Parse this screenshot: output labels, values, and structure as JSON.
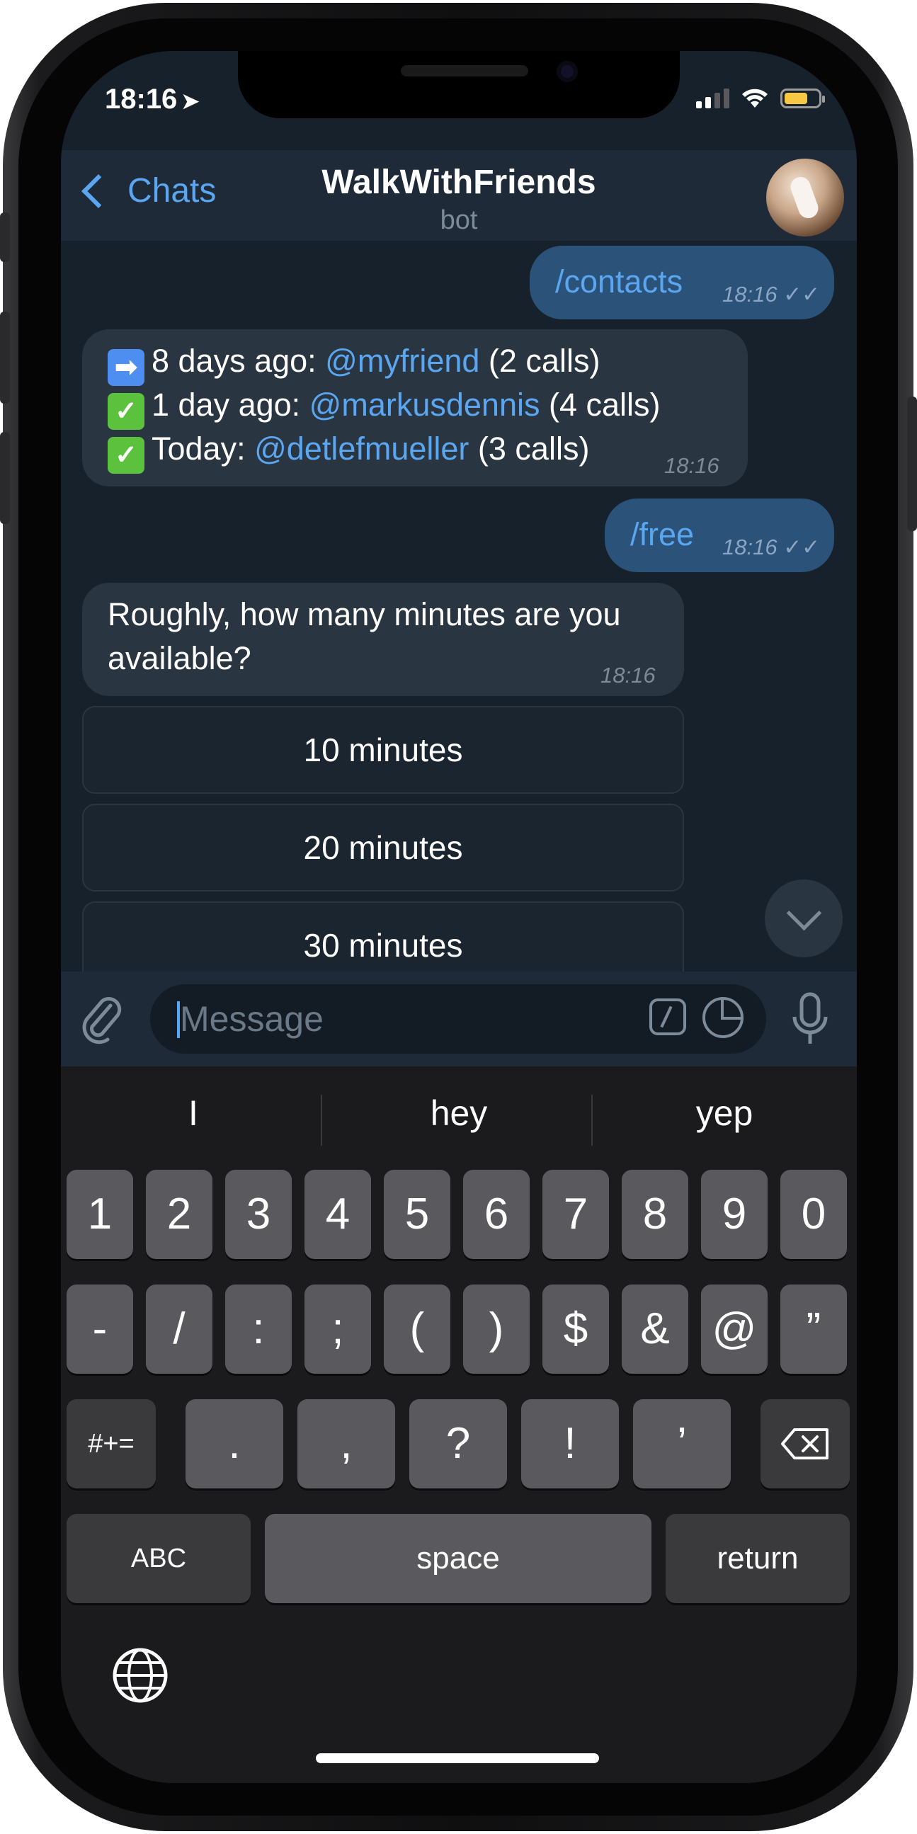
{
  "status_bar": {
    "time": "18:16",
    "location_glyph": "➤"
  },
  "header": {
    "back_label": "Chats",
    "title": "WalkWithFriends",
    "subtitle": "bot"
  },
  "messages": {
    "contacts_cmd": {
      "text": "/contacts",
      "time": "18:16",
      "read_glyph": "✓✓"
    },
    "contacts_list": {
      "rows": [
        {
          "emoji": "➡",
          "prefix": "8 days ago: ",
          "handle": "@myfriend",
          "suffix": " (2 calls)"
        },
        {
          "emoji": "✓",
          "prefix": "1 day ago: ",
          "handle": "@markusdennis",
          "suffix": " (4 calls)"
        },
        {
          "emoji": "✓",
          "prefix": "Today: ",
          "handle": "@detlefmueller",
          "suffix": " (3 calls)"
        }
      ],
      "time": "18:16"
    },
    "free_cmd": {
      "text": "/free",
      "time": "18:16",
      "read_glyph": "✓✓"
    },
    "question": {
      "line1": "Roughly, how many minutes are you",
      "line2": "available?",
      "time": "18:16"
    }
  },
  "keyboard_buttons": [
    "10 minutes",
    "20 minutes",
    "30 minutes"
  ],
  "input": {
    "placeholder": "Message"
  },
  "suggestions": [
    "I",
    "hey",
    "yep"
  ],
  "keys": {
    "row1": [
      "1",
      "2",
      "3",
      "4",
      "5",
      "6",
      "7",
      "8",
      "9",
      "0"
    ],
    "row2": [
      "-",
      "/",
      ":",
      ";",
      "(",
      ")",
      "$",
      "&",
      "@",
      "”"
    ],
    "row3_left": "#+=",
    "row3": [
      ".",
      ",",
      "?",
      "!",
      "’"
    ],
    "abc": "ABC",
    "space": "space",
    "return": "return"
  },
  "colors": {
    "accent": "#5aa6f0",
    "chat_bg": "#17212b",
    "out_bubble": "#2b5278",
    "in_bubble": "#2a3542",
    "battery": "#f7c843"
  }
}
